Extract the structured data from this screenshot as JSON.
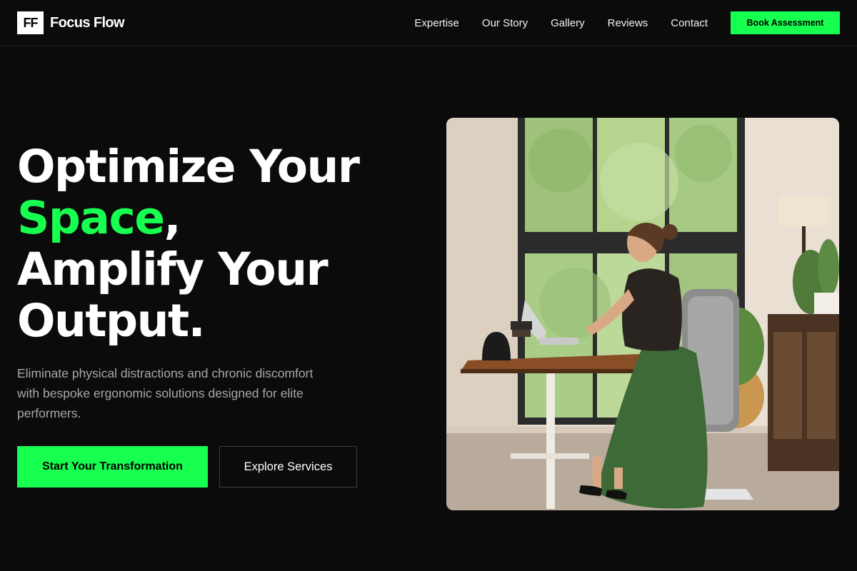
{
  "brand": {
    "logo_text": "FF",
    "name": "Focus Flow"
  },
  "nav": {
    "links": [
      "Expertise",
      "Our Story",
      "Gallery",
      "Reviews",
      "Contact"
    ],
    "cta_label": "Book Assessment"
  },
  "hero": {
    "headline_line1": "Optimize Your",
    "headline_accent": "Space",
    "headline_comma": ",",
    "headline_line3": "Amplify Your",
    "headline_line4": "Output.",
    "subtext": "Eliminate physical distractions and chronic discomfort with bespoke ergonomic solutions designed for elite performers.",
    "primary_button": "Start Your Transformation",
    "secondary_button": "Explore Services"
  },
  "colors": {
    "accent": "#17ff4f",
    "background": "#0b0b0b",
    "subtext": "#a9a9ad"
  }
}
